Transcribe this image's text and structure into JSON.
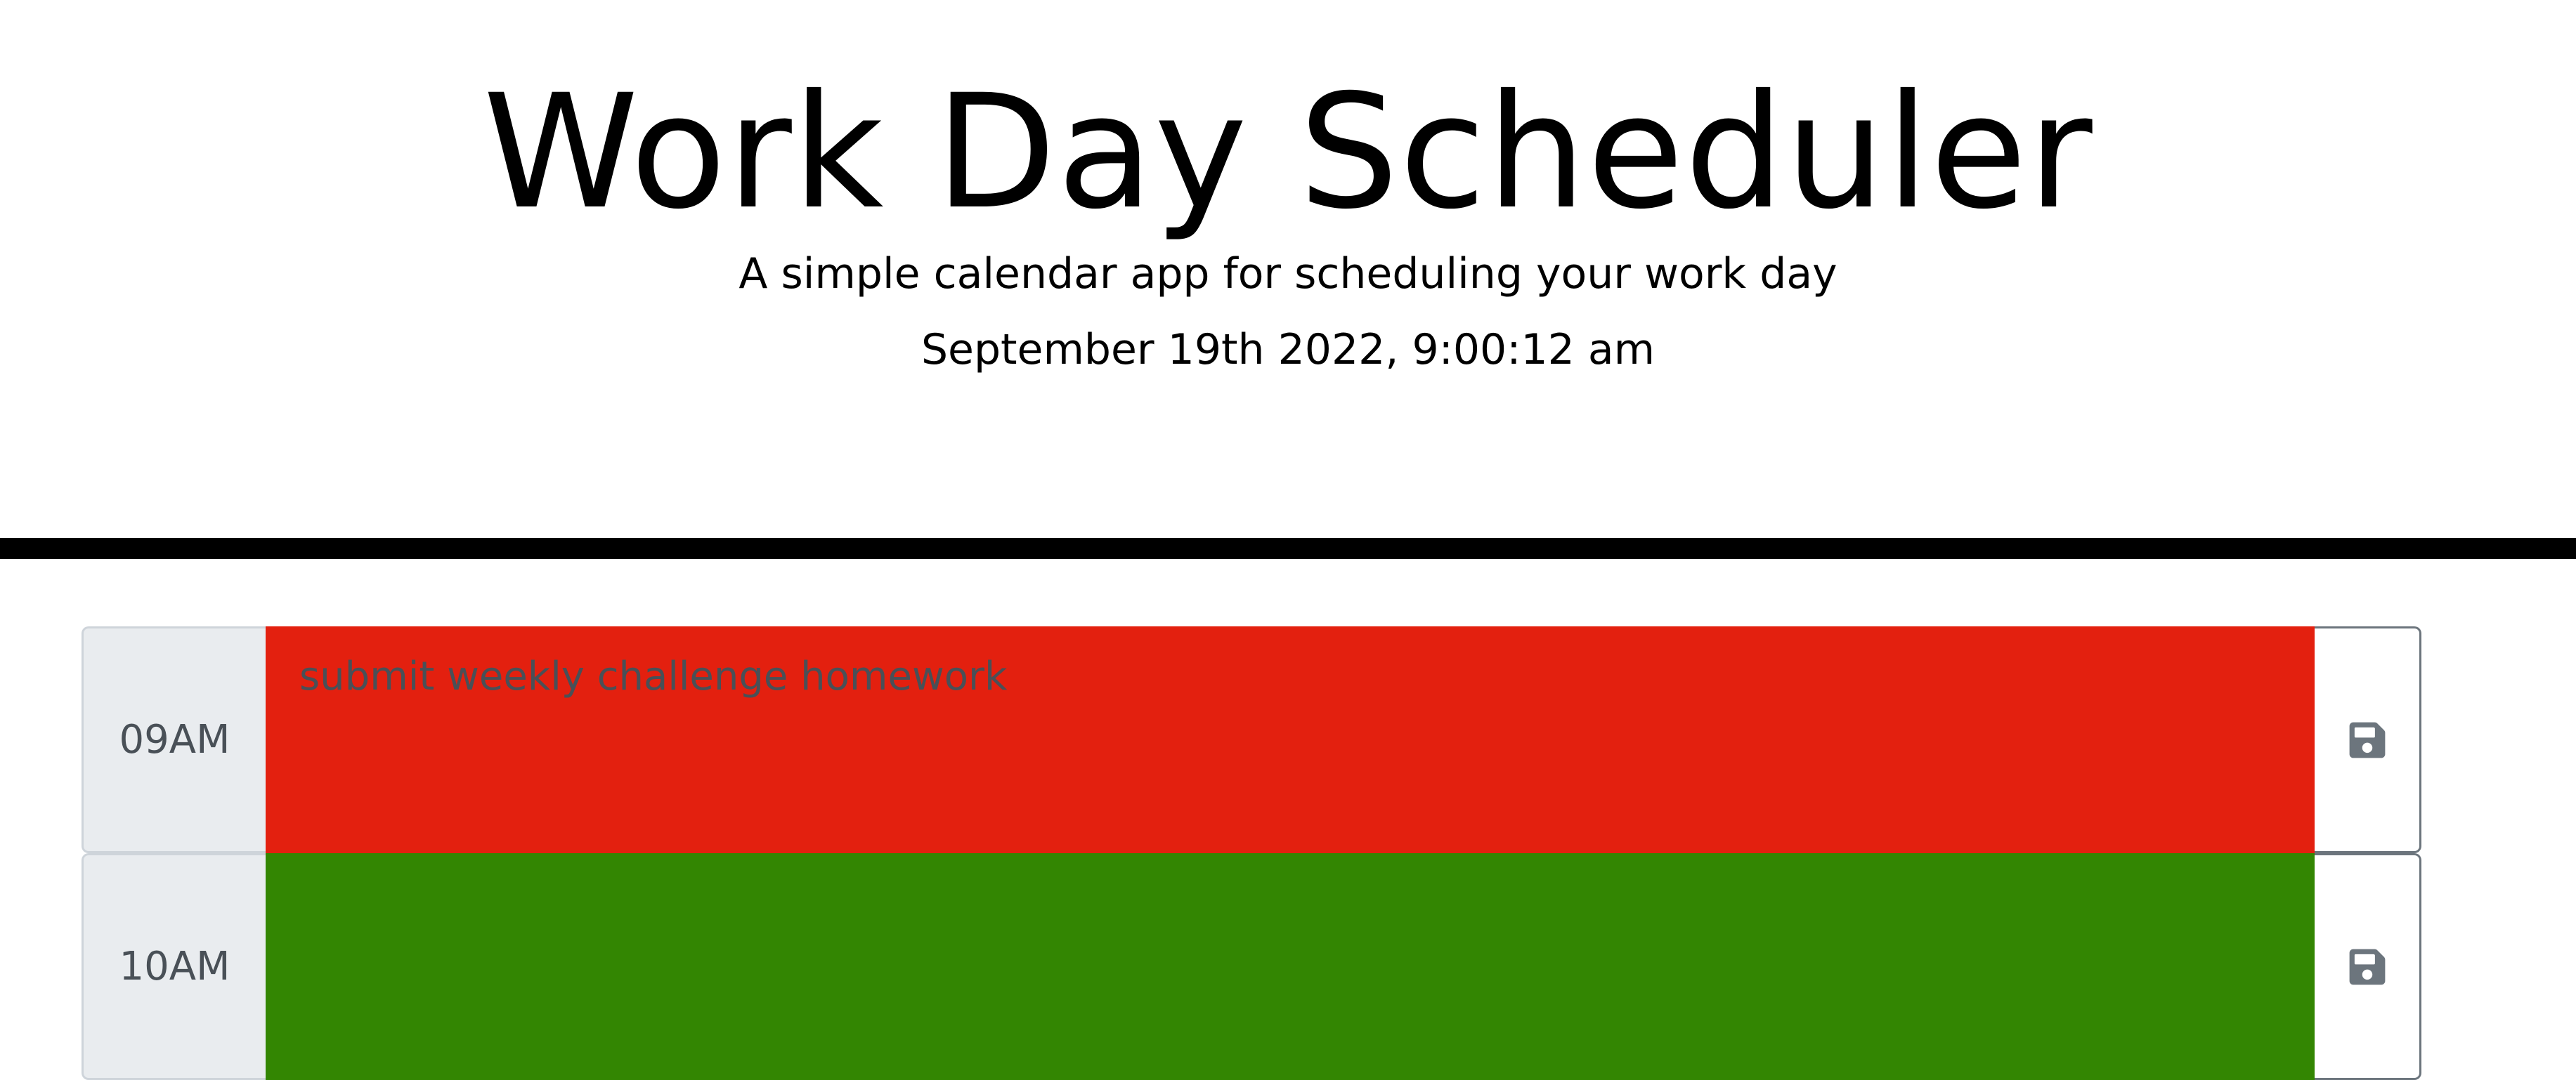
{
  "header": {
    "title": "Work Day Scheduler",
    "lead": "A simple calendar app for scheduling your work day",
    "current_datetime": "September 19th 2022, 9:00:12 am"
  },
  "colors": {
    "present": "#e3200f",
    "future": "#338602",
    "hour_bg": "#e9ecef",
    "save_icon": "#6c757d",
    "divider": "#000000"
  },
  "rows": [
    {
      "hour": "09AM",
      "text": "submit weekly challenge homework",
      "state": "present",
      "save_icon": "floppy-disk-icon"
    },
    {
      "hour": "10AM",
      "text": "",
      "state": "future",
      "save_icon": "floppy-disk-icon"
    }
  ]
}
